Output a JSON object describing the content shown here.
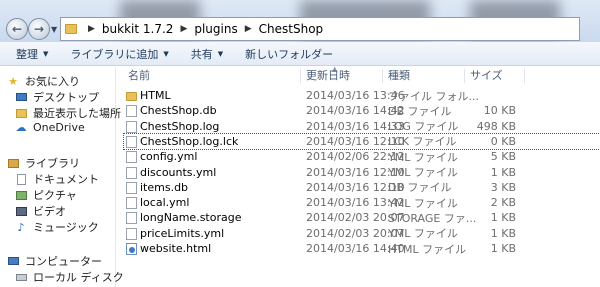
{
  "address": {
    "crumbs": [
      "bukkit 1.7.2",
      "plugins",
      "ChestShop"
    ]
  },
  "toolbar": {
    "organize": "整理",
    "include_in_library": "ライブラリに追加",
    "share": "共有",
    "new_folder": "新しいフォルダー"
  },
  "nav": {
    "favorites": "お気に入り",
    "desktop": "デスクトップ",
    "recent_places": "最近表示した場所",
    "onedrive": "OneDrive",
    "libraries": "ライブラリ",
    "documents": "ドキュメント",
    "pictures": "ピクチャ",
    "videos": "ビデオ",
    "music": "ミュージック",
    "computer": "コンピューター",
    "local_disk": "ローカル ディスク"
  },
  "columns": {
    "name": "名前",
    "date": "更新日時",
    "type": "種類",
    "size": "サイズ"
  },
  "files": [
    {
      "name": "HTML",
      "date": "2014/03/16 13:46",
      "type": "ファイル フォル...",
      "size": "",
      "icon": "folder-icon"
    },
    {
      "name": "ChestShop.db",
      "date": "2014/03/16 14:42",
      "type": "DB ファイル",
      "size": "10 KB",
      "icon": "file-icon"
    },
    {
      "name": "ChestShop.log",
      "date": "2014/03/16 14:33",
      "type": "LOG ファイル",
      "size": "498 KB",
      "icon": "file-icon"
    },
    {
      "name": "ChestShop.log.lck",
      "date": "2014/03/16 12:10",
      "type": "LCK ファイル",
      "size": "0 KB",
      "icon": "file-icon"
    },
    {
      "name": "config.yml",
      "date": "2014/02/06 22:12",
      "type": "YML ファイル",
      "size": "5 KB",
      "icon": "file-icon"
    },
    {
      "name": "discounts.yml",
      "date": "2014/03/16 12:10",
      "type": "YML ファイル",
      "size": "1 KB",
      "icon": "file-icon"
    },
    {
      "name": "items.db",
      "date": "2014/03/16 12:10",
      "type": "DB ファイル",
      "size": "3 KB",
      "icon": "file-icon"
    },
    {
      "name": "local.yml",
      "date": "2014/03/16 13:42",
      "type": "YML ファイル",
      "size": "2 KB",
      "icon": "file-icon"
    },
    {
      "name": "longName.storage",
      "date": "2014/02/03 20:07",
      "type": "STORAGE ファ...",
      "size": "1 KB",
      "icon": "file-icon"
    },
    {
      "name": "priceLimits.yml",
      "date": "2014/02/03 20:07",
      "type": "YML ファイル",
      "size": "1 KB",
      "icon": "file-icon"
    },
    {
      "name": "website.html",
      "date": "2014/03/16 14:40",
      "type": "HTML ファイル",
      "size": "1 KB",
      "icon": "html-file-icon"
    }
  ]
}
